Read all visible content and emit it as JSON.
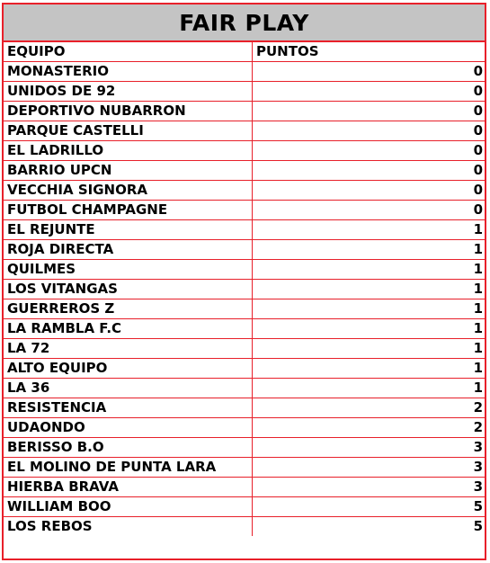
{
  "title": "FAIR PLAY",
  "headers": {
    "team": "EQUIPO",
    "points": "PUNTOS"
  },
  "colors": {
    "border": "#e8202a",
    "title_bg": "#c4c4c4"
  },
  "rows": [
    {
      "team": "MONASTERIO",
      "points": "0"
    },
    {
      "team": "UNIDOS DE 92",
      "points": "0"
    },
    {
      "team": "DEPORTIVO NUBARRON",
      "points": "0"
    },
    {
      "team": "PARQUE CASTELLI",
      "points": "0"
    },
    {
      "team": "EL LADRILLO",
      "points": "0"
    },
    {
      "team": "BARRIO UPCN",
      "points": "0"
    },
    {
      "team": "VECCHIA SIGNORA",
      "points": "0"
    },
    {
      "team": "FUTBOL CHAMPAGNE",
      "points": "0"
    },
    {
      "team": "EL REJUNTE",
      "points": "1"
    },
    {
      "team": "ROJA DIRECTA",
      "points": "1"
    },
    {
      "team": "QUILMES",
      "points": "1"
    },
    {
      "team": "LOS VITANGAS",
      "points": "1"
    },
    {
      "team": "GUERREROS Z",
      "points": "1"
    },
    {
      "team": "LA RAMBLA F.C",
      "points": "1"
    },
    {
      "team": "LA 72",
      "points": "1"
    },
    {
      "team": "ALTO EQUIPO",
      "points": "1"
    },
    {
      "team": "LA 36",
      "points": "1"
    },
    {
      "team": "RESISTENCIA",
      "points": "2"
    },
    {
      "team": "UDAONDO",
      "points": "2"
    },
    {
      "team": "BERISSO B.O",
      "points": "3"
    },
    {
      "team": "EL MOLINO DE PUNTA LARA",
      "points": "3"
    },
    {
      "team": "HIERBA BRAVA",
      "points": "3"
    },
    {
      "team": "WILLIAM BOO",
      "points": "5"
    },
    {
      "team": "LOS REBOS",
      "points": "5"
    }
  ]
}
